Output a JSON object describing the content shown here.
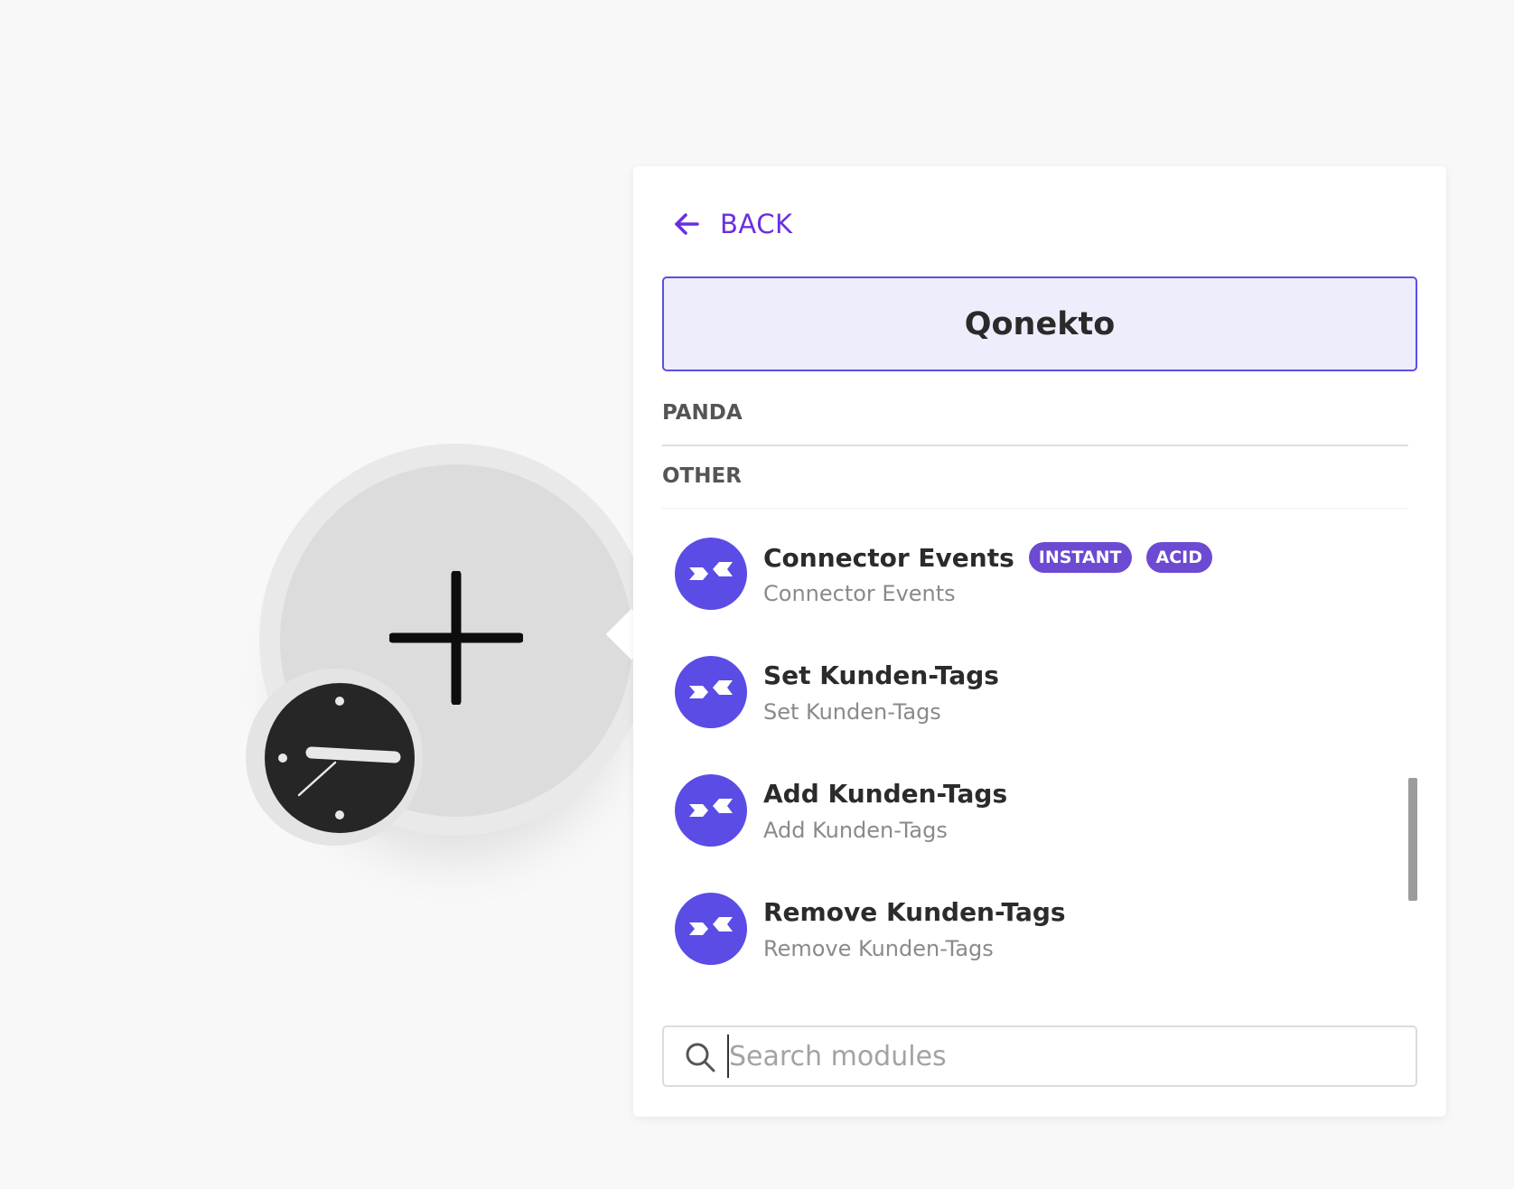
{
  "canvas": {
    "add_module_icon": "plus-icon",
    "trigger_icon": "clock-icon"
  },
  "panel": {
    "back_label": "BACK",
    "app_title": "Qonekto",
    "sections": {
      "panda": "PANDA",
      "other": "OTHER"
    },
    "modules": [
      {
        "title": "Connector Events",
        "subtitle": "Connector Events",
        "badges": [
          "INSTANT",
          "ACID"
        ],
        "icon": "qonekto-logo-icon"
      },
      {
        "title": "Set Kunden-Tags",
        "subtitle": "Set Kunden-Tags",
        "badges": [],
        "icon": "qonekto-logo-icon"
      },
      {
        "title": "Add Kunden-Tags",
        "subtitle": "Add Kunden-Tags",
        "badges": [],
        "icon": "qonekto-logo-icon"
      },
      {
        "title": "Remove Kunden-Tags",
        "subtitle": "Remove Kunden-Tags",
        "badges": [],
        "icon": "qonekto-logo-icon"
      }
    ],
    "search": {
      "placeholder": "Search modules",
      "value": ""
    }
  },
  "colors": {
    "accent": "#6a2ee0",
    "brand_icon": "#5b4ce6",
    "badge": "#6c4ad2",
    "title_box_bg": "#eeedfb",
    "title_box_border": "#5b4fe3",
    "canvas_bg": "#f8f8f8"
  }
}
